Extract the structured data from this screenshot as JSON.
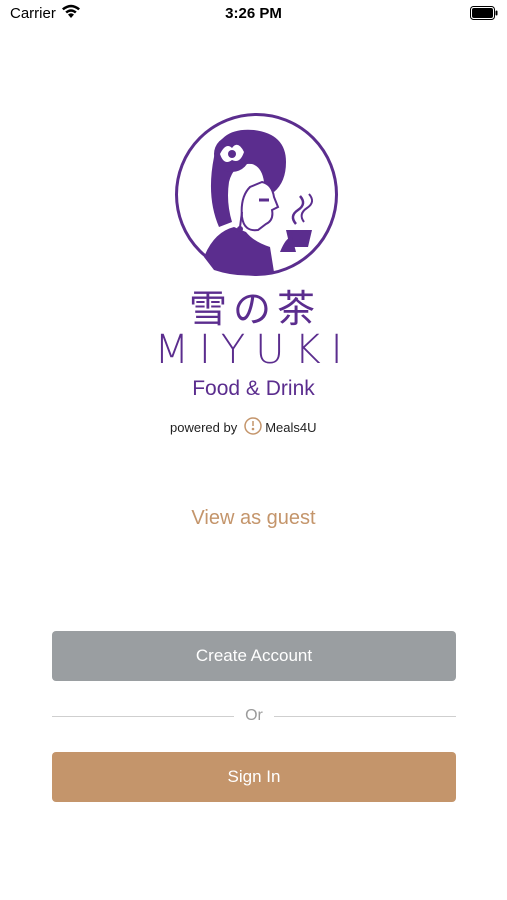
{
  "status_bar": {
    "carrier": "Carrier",
    "time": "3:26 PM"
  },
  "logo": {
    "kanji": "雪の茶",
    "wordmark": "MIYUKI",
    "subtitle": "Food & Drink",
    "brand_color": "#5b2d8e"
  },
  "powered_by": {
    "label": "powered by",
    "provider": "Meals4U"
  },
  "guest_link": "View as guest",
  "create_account_button": "Create Account",
  "divider_text": "Or",
  "sign_in_button": "Sign In",
  "colors": {
    "accent": "#c4956b",
    "create_button_bg": "#9a9ea1",
    "sign_in_button_bg": "#c4956b"
  }
}
